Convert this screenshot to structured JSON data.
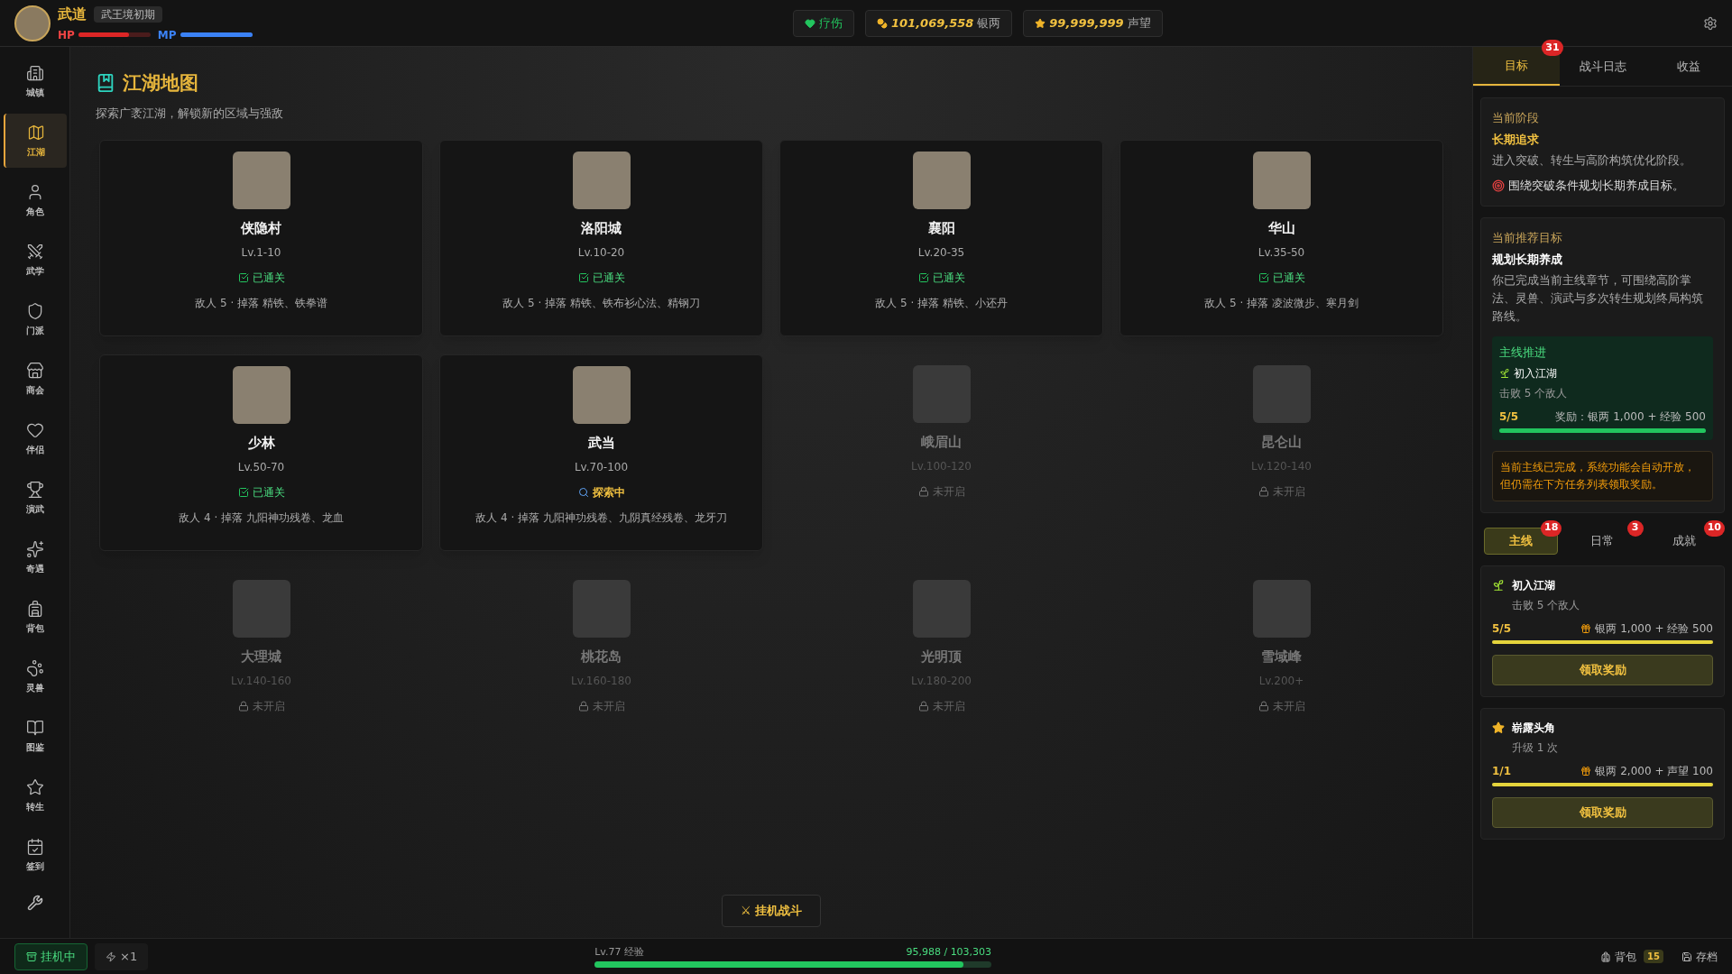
{
  "player": {
    "name": "武道",
    "realm": "武王境初期",
    "hp_label": "HP",
    "hp": {
      "level": 0.7
    },
    "mp_label": "MP",
    "mp": {
      "level": 1
    }
  },
  "top_actions": [
    {
      "kind": "heal",
      "label": "疗伤"
    },
    {
      "kind": "silver",
      "value": "101,069,558",
      "unit": "银两"
    },
    {
      "kind": "fame",
      "value": "99,999,999",
      "unit": "声望"
    }
  ],
  "sidebar": {
    "items": [
      {
        "label": "城镇",
        "selected": false
      },
      {
        "label": "江湖",
        "selected": true
      },
      {
        "label": "角色",
        "selected": false
      },
      {
        "label": "武学",
        "selected": false
      },
      {
        "label": "门派",
        "selected": false
      },
      {
        "label": "商会",
        "selected": false
      },
      {
        "label": "伴侣",
        "selected": false
      },
      {
        "label": "演武",
        "selected": false
      },
      {
        "label": "奇遇",
        "selected": false
      },
      {
        "label": "背包",
        "selected": false
      },
      {
        "label": "灵兽",
        "selected": false
      },
      {
        "label": "图鉴",
        "selected": false
      },
      {
        "label": "转生",
        "selected": false
      },
      {
        "label": "签到",
        "selected": false
      }
    ]
  },
  "map": {
    "title": "江湖地图",
    "subtitle": "探索广袤江湖，解锁新的区域与强敌",
    "regions": [
      {
        "name": "侠隐村",
        "level": "Lv.1-10",
        "kind": "cleared",
        "status_label": "已通关",
        "info": "敌人 5 · 掉落 精铁、铁拳谱"
      },
      {
        "name": "洛阳城",
        "level": "Lv.10-20",
        "kind": "cleared",
        "status_label": "已通关",
        "info": "敌人 5 · 掉落 精铁、铁布衫心法、精钢刀"
      },
      {
        "name": "襄阳",
        "level": "Lv.20-35",
        "kind": "cleared",
        "status_label": "已通关",
        "info": "敌人 5 · 掉落 精铁、小还丹"
      },
      {
        "name": "华山",
        "level": "Lv.35-50",
        "kind": "cleared",
        "status_label": "已通关",
        "info": "敌人 5 · 掉落 凌波微步、寒月剑"
      },
      {
        "name": "少林",
        "level": "Lv.50-70",
        "kind": "cleared",
        "status_label": "已通关",
        "info": "敌人 4 · 掉落 九阳神功残卷、龙血"
      },
      {
        "name": "武当",
        "level": "Lv.70-100",
        "kind": "exploring",
        "status_label": "探索中",
        "info": "敌人 4 · 掉落 九阳神功残卷、九阴真经残卷、龙牙刀"
      },
      {
        "name": "峨眉山",
        "level": "Lv.100-120",
        "kind": "locked",
        "status_label": "未开启"
      },
      {
        "name": "昆仑山",
        "level": "Lv.120-140",
        "kind": "locked",
        "status_label": "未开启"
      },
      {
        "name": "大理城",
        "level": "Lv.140-160",
        "kind": "locked",
        "status_label": "未开启"
      },
      {
        "name": "桃花岛",
        "level": "Lv.160-180",
        "kind": "locked",
        "status_label": "未开启"
      },
      {
        "name": "光明顶",
        "level": "Lv.180-200",
        "kind": "locked",
        "status_label": "未开启"
      },
      {
        "name": "雪域峰",
        "level": "Lv.200+",
        "kind": "locked",
        "status_label": "未开启"
      }
    ]
  },
  "auto_battle_button": "⚔ 挂机战斗",
  "right_panel": {
    "tabs": [
      {
        "label": "目标",
        "selected": true,
        "badge": "31"
      },
      {
        "label": "战斗日志",
        "selected": false
      },
      {
        "label": "收益",
        "selected": false
      }
    ],
    "stage": {
      "heading": "当前阶段",
      "title": "长期追求",
      "text": "进入突破、转生与高阶构筑优化阶段。",
      "tip": "围绕突破条件规划长期养成目标。"
    },
    "recommend": {
      "heading": "当前推荐目标",
      "title": "规划长期养成",
      "text": "你已完成当前主线章节，可围绕高阶掌法、灵兽、演武与多次转生规划终局构筑路线。",
      "main": {
        "heading": "主线推进",
        "name": "初入江湖",
        "desc": "击败 5 个敌人",
        "progress": "5/5",
        "reward": "奖励：银两 1,000 + 经验 500",
        "level": 1
      }
    },
    "notice": "当前主线已完成，系统功能会自动开放，但仍需在下方任务列表领取奖励。",
    "quest_tabs": [
      {
        "label": "主线",
        "selected": true,
        "badge": "18"
      },
      {
        "label": "日常",
        "selected": false,
        "badge": "3"
      },
      {
        "label": "成就",
        "selected": false,
        "badge": "10"
      }
    ],
    "quests": [
      {
        "kind": "sprout",
        "name": "初入江湖",
        "desc": "击败 5 个敌人",
        "progress": "5/5",
        "reward": "银两 1,000 + 经验 500",
        "level": 1,
        "button": "领取奖励"
      },
      {
        "kind": "star",
        "name": "崭露头角",
        "desc": "升级 1 次",
        "progress": "1/1",
        "reward": "银两 2,000 + 声望 100",
        "level": 1,
        "button": "领取奖励"
      }
    ]
  },
  "status_bar": {
    "idle": "挂机中",
    "speed": "×1",
    "exp_label": "Lv.77 经验",
    "exp_value": "95,988 / 103,303",
    "exp": {
      "level": 0.93
    },
    "bag": "背包",
    "bag_count": "15",
    "save": "存档"
  }
}
